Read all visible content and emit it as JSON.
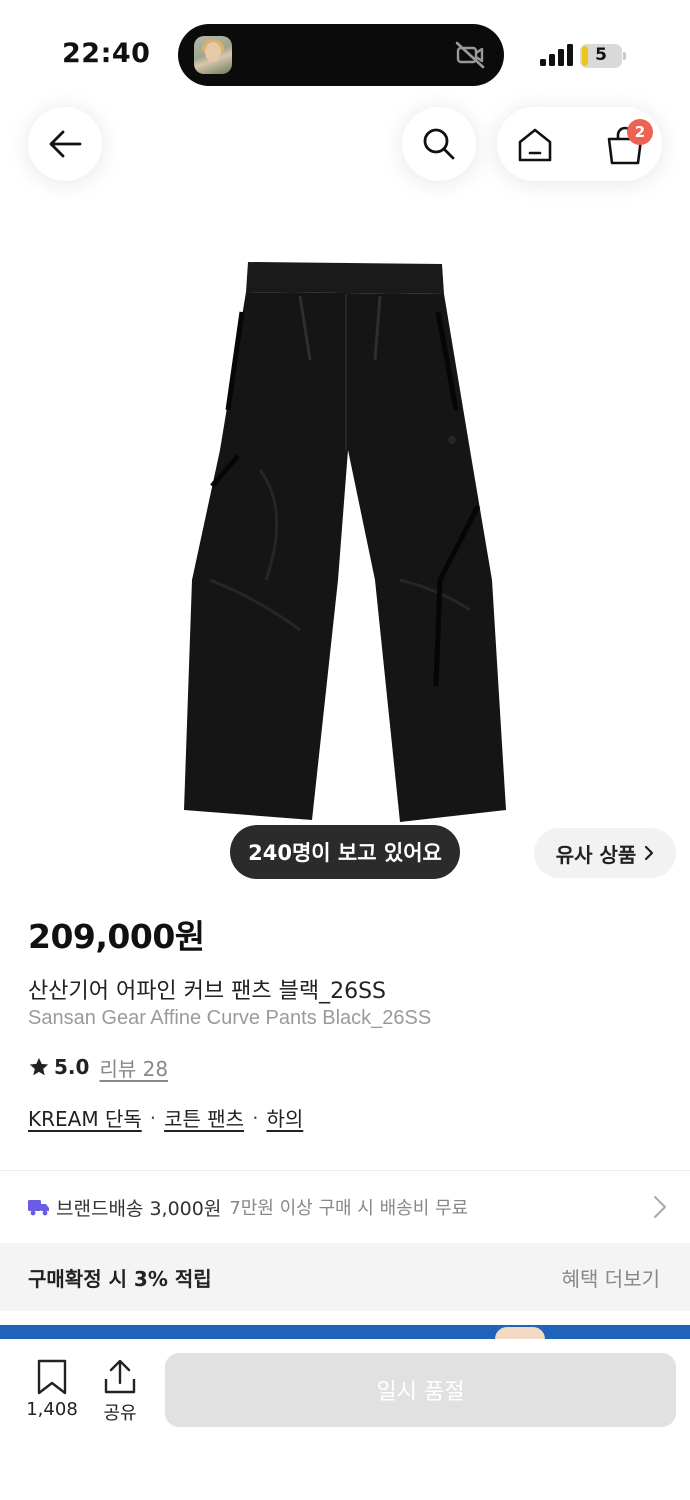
{
  "status_bar": {
    "time": "22:40",
    "battery_level": "5"
  },
  "nav": {
    "back_icon": "arrow-left-icon",
    "search_icon": "search-icon",
    "home_icon": "home-icon",
    "cart_icon": "shopping-bag-icon",
    "cart_badge": "2"
  },
  "product": {
    "viewers": "240명이 보고 있어요",
    "similar_label": "유사 상품",
    "price": "209,000원",
    "name_ko": "산산기어 어파인 커브 팬츠 블랙_26SS",
    "name_en": "Sansan Gear Affine Curve Pants Black_26SS",
    "rating": "5.0",
    "review_label": "리뷰 28",
    "tags": [
      "KREAM 단독",
      "코튼 팬츠",
      "하의"
    ]
  },
  "delivery": {
    "label": "브랜드배송 3,000원",
    "note": "7만원 이상 구매 시 배송비 무료"
  },
  "points": {
    "text": "구매확정 시 3% 적립",
    "more": "혜택 더보기"
  },
  "bottom": {
    "bookmark_count": "1,408",
    "share_label": "공유",
    "soldout_label": "일시 품절"
  },
  "colors": {
    "badge": "#ef6253",
    "delivery_icon": "#6b5ce7",
    "banner": "#1f64b8",
    "soldout_bg": "#e1e1e1"
  }
}
